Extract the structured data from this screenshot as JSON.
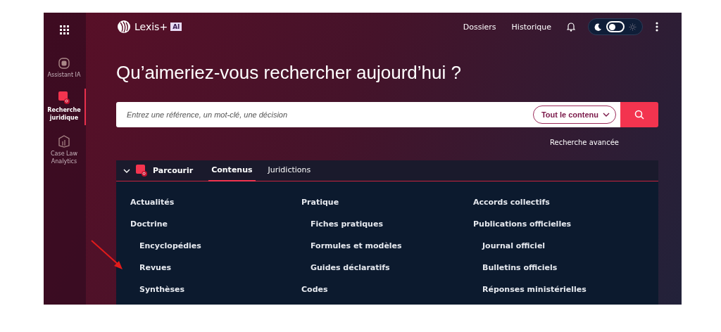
{
  "sidebar": {
    "items": [
      {
        "label": "Assistant IA",
        "kind": "chat",
        "selected": false
      },
      {
        "label": "Recherche juridique",
        "kind": "search",
        "selected": true
      },
      {
        "label": "Case Law Analytics",
        "kind": "chart",
        "selected": false
      }
    ]
  },
  "header": {
    "logo": {
      "name": "Lexis+",
      "badge": "AI"
    },
    "nav": [
      "Dossiers",
      "Historique"
    ],
    "theme_toggle": {
      "light": false
    }
  },
  "title": "Qu’aimeriez-vous rechercher aujourd’hui ?",
  "search": {
    "placeholder": "Entrez une référence, un mot-clé, une décision",
    "scope": "Tout le contenu"
  },
  "advanced_link": "Recherche avancée",
  "browse": {
    "title": "Parcourir",
    "expanded": true,
    "tabs": [
      {
        "label": "Contenus",
        "selected": true
      },
      {
        "label": "Juridictions",
        "selected": false
      }
    ],
    "columns": [
      [
        {
          "label": "Actualités"
        },
        {
          "label": "Doctrine",
          "children": [
            {
              "label": "Encyclopédies"
            },
            {
              "label": "Revues"
            },
            {
              "label": "Synthèses"
            }
          ]
        }
      ],
      [
        {
          "label": "Pratique",
          "children": [
            {
              "label": "Fiches pratiques"
            },
            {
              "label": "Formules et modèles"
            },
            {
              "label": "Guides déclaratifs"
            }
          ]
        },
        {
          "label": "Codes"
        }
      ],
      [
        {
          "label": "Accords collectifs"
        },
        {
          "label": "Publications officielles",
          "children": [
            {
              "label": "Journal officiel"
            },
            {
              "label": "Bulletins officiels"
            },
            {
              "label": "Réponses ministérielles"
            }
          ]
        }
      ]
    ]
  }
}
